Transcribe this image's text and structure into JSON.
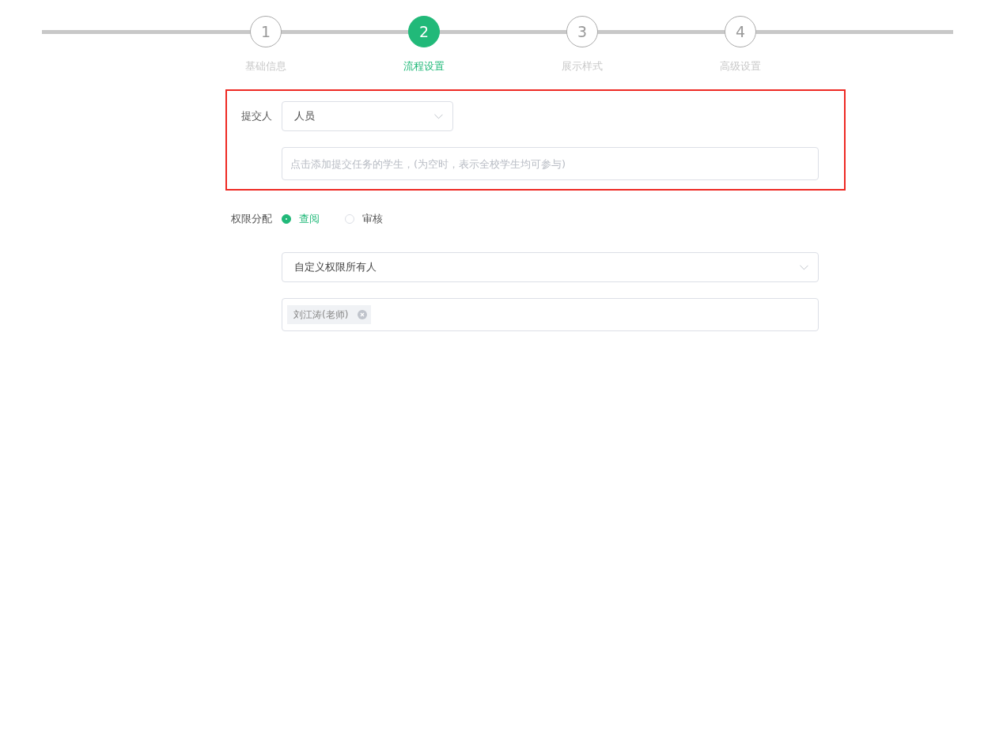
{
  "steps": [
    {
      "number": "1",
      "label": "基础信息",
      "selected": false
    },
    {
      "number": "2",
      "label": "流程设置",
      "selected": true
    },
    {
      "number": "3",
      "label": "展示样式",
      "selected": false
    },
    {
      "number": "4",
      "label": "高级设置",
      "selected": false
    }
  ],
  "submitter": {
    "highlighted": true,
    "label": "提交人",
    "select": {
      "value": "人员"
    },
    "input": {
      "placeholder": "点击添加提交任务的学生，(为空时，表示全校学生均可参与)"
    }
  },
  "permission": {
    "label": "权限分配",
    "radios": [
      {
        "label": "查阅",
        "selected": true
      },
      {
        "label": "审核",
        "selected": false
      }
    ],
    "select": {
      "value": "自定义权限所有人"
    },
    "tags": [
      {
        "label": "刘江涛(老师)"
      }
    ]
  }
}
